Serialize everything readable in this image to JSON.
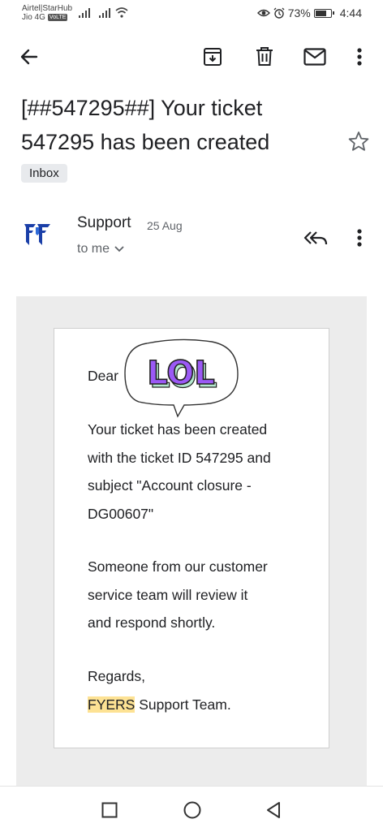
{
  "status_bar": {
    "carrier_line1": "Airtel|StarHub",
    "carrier_line2": "Jio 4G",
    "volte": "VoLTE",
    "battery": "73%",
    "battery_level": 0.73,
    "time": "4:44",
    "icons": [
      "signal-icon",
      "signal-icon",
      "wifi-icon",
      "eye-icon",
      "alarm-icon",
      "battery-icon"
    ]
  },
  "toolbar": {
    "icons": [
      "back-arrow-icon",
      "archive-icon",
      "delete-icon",
      "mail-icon",
      "more-vert-icon"
    ]
  },
  "email": {
    "subject": "[##547295##] Your ticket 547295 has been created",
    "label": "Inbox",
    "sender": "Support",
    "date": "25 Aug",
    "recipient": "to me",
    "sticker_text": "LOL",
    "body": {
      "greeting": "Dear",
      "paragraph1": [
        "Your ticket has been created",
        "with the ticket ID 547295 and",
        "subject \"Account closure -",
        "DG00607\""
      ],
      "paragraph2": [
        "Someone from our customer",
        "service team will review it",
        "and respond shortly."
      ],
      "closing": "Regards,",
      "signature_highlight": "FYERS",
      "signature_rest": " Support Team."
    }
  },
  "colors": {
    "brand": "#1a3fa8",
    "sticker_purple": "#9b59f5",
    "sticker_green": "#b5ead0",
    "highlight": "#fde294"
  }
}
